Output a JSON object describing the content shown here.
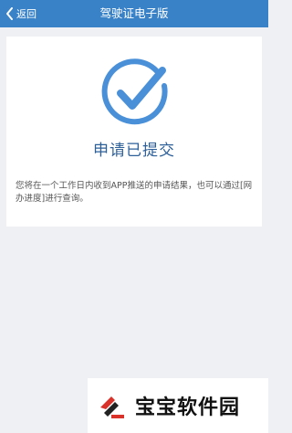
{
  "header": {
    "back_label": "返回",
    "title": "驾驶证电子版"
  },
  "result": {
    "icon": "check-circle-icon",
    "title": "申请已提交",
    "description": "您将在一个工作日内收到APP推送的申请结果，也可以通过[网办进度]进行查询。"
  },
  "watermark": {
    "logo_icon": "baobao-logo-icon",
    "text": "宝宝软件园"
  },
  "colors": {
    "nav_bar": "#3a82c8",
    "accent_blue": "#4a90d9",
    "title_blue": "#2d5f99",
    "page_background": "#eef0f3",
    "logo_red": "#d9322b"
  }
}
